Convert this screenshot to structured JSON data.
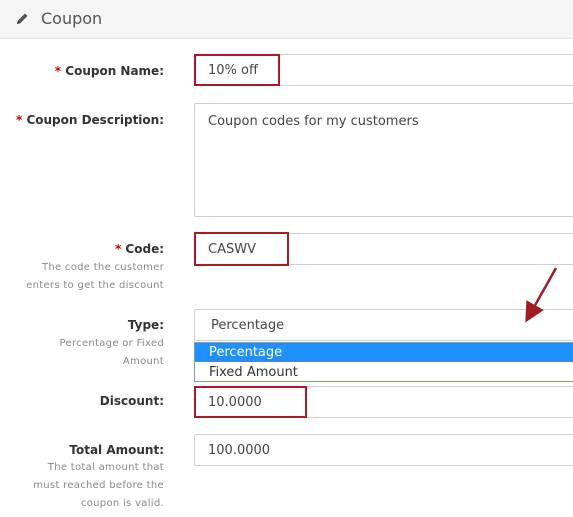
{
  "header": {
    "title": "Coupon",
    "icon": "pencil-icon"
  },
  "form": {
    "coupon_name": {
      "label": "Coupon Name:",
      "required_mark": "*",
      "value": "10% off"
    },
    "coupon_description": {
      "label": "Coupon Description:",
      "required_mark": "*",
      "value": "Coupon codes for my customers"
    },
    "code": {
      "label": "Code:",
      "required_mark": "*",
      "value": "CASWV",
      "help_lines": [
        "The code the customer",
        "enters to get the discount"
      ]
    },
    "type": {
      "label": "Type:",
      "value": "Percentage",
      "help_lines": [
        "Percentage or Fixed",
        "Amount"
      ],
      "options": [
        "Percentage",
        "Fixed Amount"
      ]
    },
    "discount": {
      "label": "Discount:",
      "value": "10.0000"
    },
    "total_amount": {
      "label": "Total Amount:",
      "value": "100.0000",
      "help_lines": [
        "The total amount that",
        "must reached before the",
        "coupon is valid."
      ]
    }
  },
  "colors": {
    "highlight": "#b0182a",
    "selected_option": "#1e90ff",
    "required": "#cc0000"
  }
}
